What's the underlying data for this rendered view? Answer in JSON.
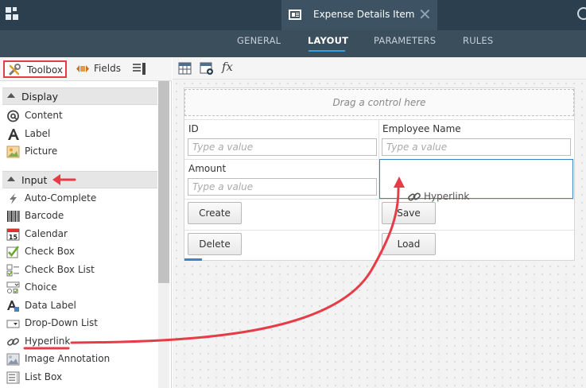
{
  "header": {
    "doc_tab_title": "Expense Details Item"
  },
  "nav": {
    "tabs": [
      {
        "label": "GENERAL",
        "active": false
      },
      {
        "label": "LAYOUT",
        "active": true
      },
      {
        "label": "PARAMETERS",
        "active": false
      },
      {
        "label": "RULES",
        "active": false
      }
    ]
  },
  "panel": {
    "tabs": [
      {
        "label": "Toolbox",
        "icon": "tools-icon",
        "highlighted": true
      },
      {
        "label": "Fields",
        "icon": "fields-icon"
      },
      {
        "label": "",
        "icon": "properties-icon"
      }
    ],
    "sections": [
      {
        "label": "Display",
        "items": [
          {
            "label": "Content",
            "icon": "at-sign-icon"
          },
          {
            "label": "Label",
            "icon": "letter-a-icon"
          },
          {
            "label": "Picture",
            "icon": "picture-icon"
          }
        ]
      },
      {
        "label": "Input",
        "items": [
          {
            "label": "Auto-Complete",
            "icon": "lightning-icon"
          },
          {
            "label": "Barcode",
            "icon": "barcode-icon"
          },
          {
            "label": "Calendar",
            "icon": "calendar-icon",
            "badge": "15"
          },
          {
            "label": "Check Box",
            "icon": "checkbox-icon"
          },
          {
            "label": "Check Box List",
            "icon": "checkbox-list-icon"
          },
          {
            "label": "Choice",
            "icon": "choice-icon"
          },
          {
            "label": "Data Label",
            "icon": "data-label-icon"
          },
          {
            "label": "Drop-Down List",
            "icon": "dropdown-icon"
          },
          {
            "label": "Hyperlink",
            "icon": "link-icon"
          },
          {
            "label": "Image Annotation",
            "icon": "image-annotation-icon"
          },
          {
            "label": "List Box",
            "icon": "list-box-icon"
          }
        ]
      }
    ]
  },
  "canvas": {
    "drag_placeholder": "Drag a control here",
    "fields": [
      {
        "label": "ID",
        "placeholder": "Type a value"
      },
      {
        "label": "Employee Name",
        "placeholder": "Type a value"
      },
      {
        "label": "Amount",
        "placeholder": "Type a value"
      }
    ],
    "buttons": [
      "Create",
      "Save",
      "Delete",
      "Load"
    ],
    "drag_ghost_label": "Hyperlink"
  },
  "colors": {
    "header_bg": "#2b3f4e",
    "nav_bg": "#3b4e5c",
    "active_underline": "#36a3e0",
    "annotation_red": "#e63c48",
    "drop_target_border": "#3a85c6"
  }
}
